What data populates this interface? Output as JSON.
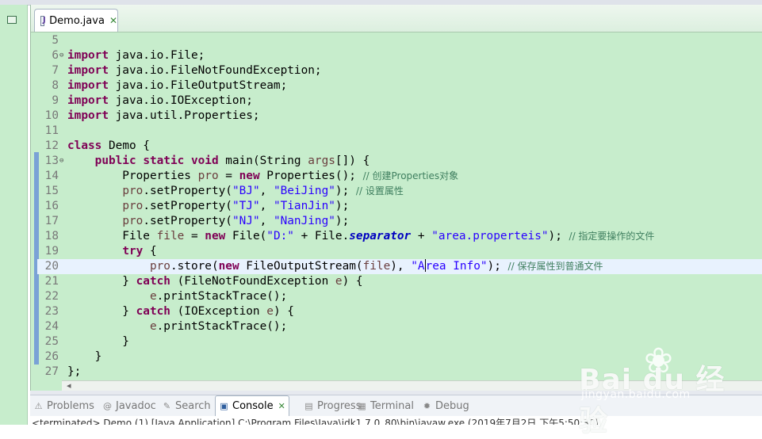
{
  "editor": {
    "tab_label": "Demo.java",
    "tab_close": "✕"
  },
  "code_lines": [
    {
      "n": "5",
      "fold": "",
      "tokens": []
    },
    {
      "n": "6",
      "fold": "⊖",
      "tokens": [
        {
          "t": "import",
          "c": "kw"
        },
        {
          "t": " java.io.File;"
        }
      ]
    },
    {
      "n": "7",
      "fold": "",
      "tokens": [
        {
          "t": "import",
          "c": "kw"
        },
        {
          "t": " java.io.FileNotFoundException;"
        }
      ]
    },
    {
      "n": "8",
      "fold": "",
      "tokens": [
        {
          "t": "import",
          "c": "kw"
        },
        {
          "t": " java.io.FileOutputStream;"
        }
      ]
    },
    {
      "n": "9",
      "fold": "",
      "tokens": [
        {
          "t": "import",
          "c": "kw"
        },
        {
          "t": " java.io.IOException;"
        }
      ]
    },
    {
      "n": "10",
      "fold": "",
      "tokens": [
        {
          "t": "import",
          "c": "kw"
        },
        {
          "t": " java.util.Properties;"
        }
      ]
    },
    {
      "n": "11",
      "fold": "",
      "tokens": []
    },
    {
      "n": "12",
      "fold": "",
      "tokens": [
        {
          "t": "class",
          "c": "kw"
        },
        {
          "t": " Demo {"
        }
      ]
    },
    {
      "n": "13",
      "fold": "⊖",
      "tokens": [
        {
          "t": "    "
        },
        {
          "t": "public",
          "c": "kw"
        },
        {
          "t": " "
        },
        {
          "t": "static",
          "c": "kw"
        },
        {
          "t": " "
        },
        {
          "t": "void",
          "c": "kw"
        },
        {
          "t": " main(String "
        },
        {
          "t": "args",
          "c": "var"
        },
        {
          "t": "[]) {"
        }
      ]
    },
    {
      "n": "14",
      "fold": "",
      "tokens": [
        {
          "t": "        Properties "
        },
        {
          "t": "pro",
          "c": "var"
        },
        {
          "t": " = "
        },
        {
          "t": "new",
          "c": "kw"
        },
        {
          "t": " Properties(); "
        },
        {
          "t": "// 创建Properties对象",
          "c": "cm"
        }
      ]
    },
    {
      "n": "15",
      "fold": "",
      "tokens": [
        {
          "t": "        "
        },
        {
          "t": "pro",
          "c": "var"
        },
        {
          "t": ".setProperty("
        },
        {
          "t": "\"BJ\"",
          "c": "str"
        },
        {
          "t": ", "
        },
        {
          "t": "\"BeiJing\"",
          "c": "str"
        },
        {
          "t": "); "
        },
        {
          "t": "// 设置属性",
          "c": "cm"
        }
      ]
    },
    {
      "n": "16",
      "fold": "",
      "tokens": [
        {
          "t": "        "
        },
        {
          "t": "pro",
          "c": "var"
        },
        {
          "t": ".setProperty("
        },
        {
          "t": "\"TJ\"",
          "c": "str"
        },
        {
          "t": ", "
        },
        {
          "t": "\"TianJin\"",
          "c": "str"
        },
        {
          "t": ");"
        }
      ]
    },
    {
      "n": "17",
      "fold": "",
      "tokens": [
        {
          "t": "        "
        },
        {
          "t": "pro",
          "c": "var"
        },
        {
          "t": ".setProperty("
        },
        {
          "t": "\"NJ\"",
          "c": "str"
        },
        {
          "t": ", "
        },
        {
          "t": "\"NanJing\"",
          "c": "str"
        },
        {
          "t": ");"
        }
      ]
    },
    {
      "n": "18",
      "fold": "",
      "tokens": [
        {
          "t": "        File "
        },
        {
          "t": "file",
          "c": "var"
        },
        {
          "t": " = "
        },
        {
          "t": "new",
          "c": "kw"
        },
        {
          "t": " File("
        },
        {
          "t": "\"D:\"",
          "c": "str"
        },
        {
          "t": " + File."
        },
        {
          "t": "separator",
          "c": "field"
        },
        {
          "t": " + "
        },
        {
          "t": "\"area.properteis\"",
          "c": "str"
        },
        {
          "t": "); "
        },
        {
          "t": "// 指定要操作的文件",
          "c": "cm"
        }
      ]
    },
    {
      "n": "19",
      "fold": "",
      "tokens": [
        {
          "t": "        "
        },
        {
          "t": "try",
          "c": "kw"
        },
        {
          "t": " {"
        }
      ]
    },
    {
      "n": "20",
      "fold": "",
      "current": true,
      "tokens": [
        {
          "t": "            "
        },
        {
          "t": "pro",
          "c": "var"
        },
        {
          "t": ".store("
        },
        {
          "t": "new",
          "c": "kw"
        },
        {
          "t": " FileOutputStream("
        },
        {
          "t": "file",
          "c": "var"
        },
        {
          "t": "), "
        },
        {
          "t": "\"A",
          "c": "str"
        },
        {
          "t": "",
          "c": "caret"
        },
        {
          "t": "rea Info\"",
          "c": "str"
        },
        {
          "t": "); "
        },
        {
          "t": "// 保存属性到普通文件",
          "c": "cm"
        }
      ]
    },
    {
      "n": "21",
      "fold": "",
      "tokens": [
        {
          "t": "        } "
        },
        {
          "t": "catch",
          "c": "kw"
        },
        {
          "t": " (FileNotFoundException "
        },
        {
          "t": "e",
          "c": "var"
        },
        {
          "t": ") {"
        }
      ]
    },
    {
      "n": "22",
      "fold": "",
      "tokens": [
        {
          "t": "            "
        },
        {
          "t": "e",
          "c": "var"
        },
        {
          "t": ".printStackTrace();"
        }
      ]
    },
    {
      "n": "23",
      "fold": "",
      "tokens": [
        {
          "t": "        } "
        },
        {
          "t": "catch",
          "c": "kw"
        },
        {
          "t": " (IOException "
        },
        {
          "t": "e",
          "c": "var"
        },
        {
          "t": ") {"
        }
      ]
    },
    {
      "n": "24",
      "fold": "",
      "tokens": [
        {
          "t": "            "
        },
        {
          "t": "e",
          "c": "var"
        },
        {
          "t": ".printStackTrace();"
        }
      ]
    },
    {
      "n": "25",
      "fold": "",
      "tokens": [
        {
          "t": "        }"
        }
      ]
    },
    {
      "n": "26",
      "fold": "",
      "tokens": [
        {
          "t": "    }"
        }
      ]
    },
    {
      "n": "27",
      "fold": "",
      "tokens": [
        {
          "t": "};"
        }
      ]
    }
  ],
  "bottom_tabs": [
    {
      "label": "Problems",
      "icon": "problems-icon",
      "glyph": "⚠",
      "active": false
    },
    {
      "label": "Javadoc",
      "icon": "javadoc-icon",
      "glyph": "@",
      "active": false
    },
    {
      "label": "Search",
      "icon": "search-icon",
      "glyph": "✎",
      "active": false
    },
    {
      "label": "Console",
      "icon": "console-icon",
      "glyph": "▣",
      "active": true,
      "close": "✕"
    },
    {
      "label": "Progress",
      "icon": "progress-icon",
      "glyph": "▤",
      "active": false
    },
    {
      "label": "Terminal",
      "icon": "terminal-icon",
      "glyph": "▦",
      "active": false
    },
    {
      "label": "Debug",
      "icon": "debug-icon",
      "glyph": "✹",
      "active": false
    }
  ],
  "console": {
    "status_line": "<terminated> Demo (1) [Java Application] C:\\Program Files\\Java\\jdk1.7.0_80\\bin\\javaw.exe (2019年7月2日 下午5:50:30)"
  },
  "watermark": {
    "brand": "Bai du 经验",
    "sub": "jingyan.baidu.com"
  },
  "colors": {
    "editor_bg": "#c7edcc",
    "keyword": "#7f0055",
    "string": "#2a00ff",
    "comment": "#3f7f5f",
    "current_line": "#e8f2fe"
  }
}
